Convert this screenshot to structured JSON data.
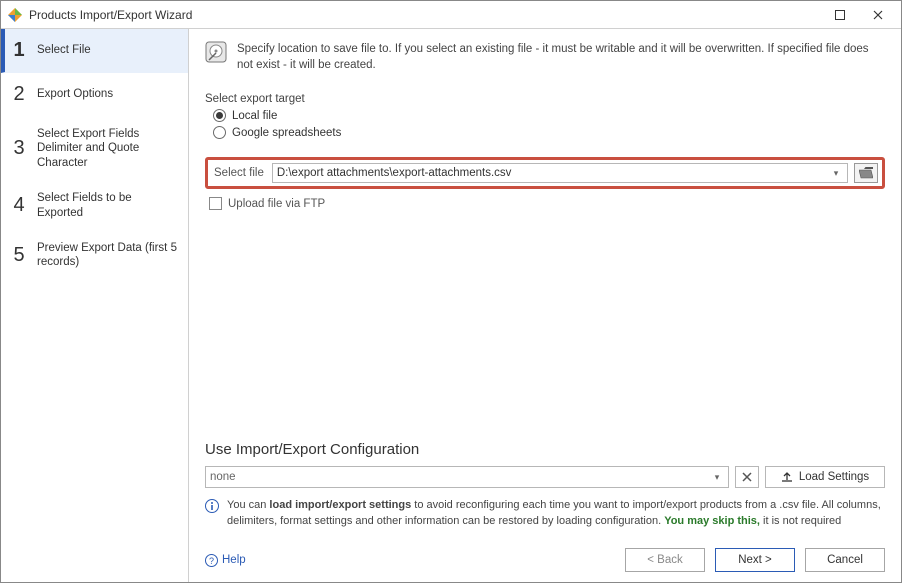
{
  "window": {
    "title": "Products Import/Export Wizard"
  },
  "sidebar": {
    "steps": [
      {
        "num": "1",
        "label": "Select File"
      },
      {
        "num": "2",
        "label": "Export Options"
      },
      {
        "num": "3",
        "label": "Select Export Fields Delimiter and Quote Character"
      },
      {
        "num": "4",
        "label": "Select Fields to be Exported"
      },
      {
        "num": "5",
        "label": "Preview Export Data (first 5 records)"
      }
    ]
  },
  "intro": {
    "text": "Specify location to save file to. If you select an existing file - it must be writable and it will be overwritten. If specified file does not exist - it will be created."
  },
  "export_target": {
    "label": "Select export target",
    "local": "Local file",
    "google": "Google spreadsheets"
  },
  "file": {
    "label": "Select file",
    "path": "D:\\export attachments\\export-attachments.csv",
    "ftp_label": "Upload file via FTP"
  },
  "config": {
    "title": "Use Import/Export Configuration",
    "selected": "none",
    "load_label": "Load Settings",
    "info_prefix": "You can ",
    "info_bold": "load import/export settings",
    "info_mid": " to avoid reconfiguring each time you want to import/export products from a .csv file. All columns, delimiters, format settings and other information can be restored by loading configuration. ",
    "info_green": "You may skip this,",
    "info_suffix": " it is not required"
  },
  "footer": {
    "help": "Help",
    "back": "< Back",
    "next": "Next >",
    "cancel": "Cancel"
  }
}
